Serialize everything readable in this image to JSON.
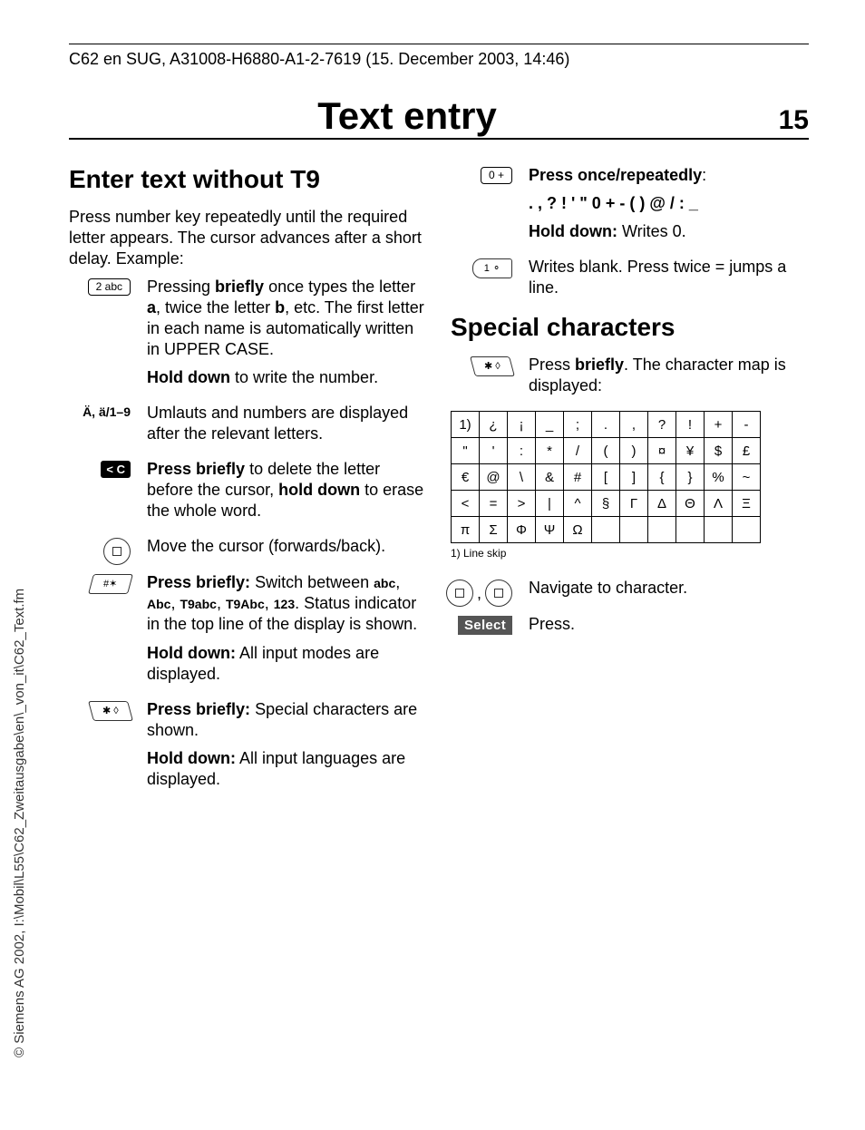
{
  "header": "C62 en SUG, A31008-H6880-A1-2-7619 (15. December 2003, 14:46)",
  "pageTitle": "Text entry",
  "pageNumber": "15",
  "copyright": "© Siemens AG 2002, I:\\Mobil\\L55\\C62_Zweitausgabe\\en\\_von_it\\C62_Text.fm",
  "left": {
    "heading": "Enter text without T9",
    "intro": "Press number key repeatedly until the required letter appears. The cursor advances after a short delay. Example:",
    "key2": "2 abc",
    "r1a": "Pressing ",
    "r1b": "briefly",
    "r1c": " once types the letter ",
    "r1d": "a",
    "r1e": ", twice the letter ",
    "r1f": "b",
    "r1g": ", etc. The first letter in each name is automatically written in UPPER CASE.",
    "r2a": "Hold down",
    "r2b": " to write the number.",
    "um_label": "Ä, ä/1–9",
    "r3": "Umlauts and numbers are displayed after the relevant letters.",
    "clear": "< C",
    "r4a": "Press briefly",
    "r4b": " to delete the letter before the cursor, ",
    "r4c": "hold down",
    "r4d": " to erase the whole word.",
    "r5": "Move the cursor (forwards/back).",
    "r6a": "Press briefly:",
    "r6b": " Switch between ",
    "r6c": "abc",
    "r6d": ", ",
    "r6e": "Abc",
    "r6f": ", ",
    "r6g": "T9abc",
    "r6h": ", ",
    "r6i": "T9Abc",
    "r6j": ", ",
    "r6k": "123",
    "r6l": ". Status indicator in the top line of the display is shown.",
    "r7a": "Hold down:",
    "r7b": " All input modes are displayed.",
    "r8a": "Press briefly:",
    "r8b": " Special characters are shown.",
    "r9a": "Hold down:",
    "r9b": " All input languages are displayed."
  },
  "right": {
    "key0": "0 +",
    "r1a": "Press once/repeatedly",
    "r1b": ". , ? ! ' \" 0 + - ( ) @ / : _",
    "r1c": "Hold down:",
    "r1d": " Writes 0.",
    "key1": "1 ⚬",
    "r2": "Writes blank. Press twice = jumps a line.",
    "heading": "Special characters",
    "r3a": "Press ",
    "r3b": "briefly",
    "r3c": ". The character map is displayed:",
    "table": [
      [
        "1)",
        "¿",
        "¡",
        "_",
        ";",
        ".",
        ",",
        "?",
        "!",
        "+",
        "-"
      ],
      [
        "\"",
        "'",
        ":",
        "*",
        "/",
        "(",
        ")",
        "¤",
        "¥",
        "$",
        "£"
      ],
      [
        "€",
        "@",
        "\\",
        "&",
        "#",
        "[",
        "]",
        "{",
        "}",
        "%",
        "~"
      ],
      [
        "<",
        "=",
        ">",
        "|",
        "^",
        "§",
        "Γ",
        "Δ",
        "Θ",
        "Λ",
        "Ξ"
      ],
      [
        "π",
        "Σ",
        "Φ",
        "Ψ",
        "Ω",
        "",
        "",
        "",
        "",
        "",
        ""
      ]
    ],
    "fn": "1) Line skip",
    "navText": "Navigate to character.",
    "select": "Select",
    "pressText": "Press."
  }
}
